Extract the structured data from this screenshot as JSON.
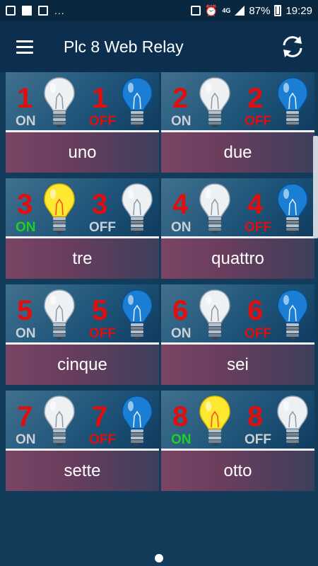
{
  "status_bar": {
    "time": "19:29",
    "battery": "87%",
    "network": "4G",
    "more": "..."
  },
  "app_bar": {
    "title": "Plc 8 Web Relay",
    "menu_icon": "hamburger-menu-icon",
    "refresh_icon": "refresh-icon"
  },
  "relays": [
    {
      "number": "1",
      "name": "uno",
      "on_label": "ON",
      "off_label": "OFF",
      "state": "off"
    },
    {
      "number": "2",
      "name": "due",
      "on_label": "ON",
      "off_label": "OFF",
      "state": "off"
    },
    {
      "number": "3",
      "name": "tre",
      "on_label": "ON",
      "off_label": "OFF",
      "state": "on"
    },
    {
      "number": "4",
      "name": "quattro",
      "on_label": "ON",
      "off_label": "OFF",
      "state": "off"
    },
    {
      "number": "5",
      "name": "cinque",
      "on_label": "ON",
      "off_label": "OFF",
      "state": "off"
    },
    {
      "number": "6",
      "name": "sei",
      "on_label": "ON",
      "off_label": "OFF",
      "state": "off"
    },
    {
      "number": "7",
      "name": "sette",
      "on_label": "ON",
      "off_label": "OFF",
      "state": "off"
    },
    {
      "number": "8",
      "name": "otto",
      "on_label": "ON",
      "off_label": "OFF",
      "state": "on"
    }
  ],
  "colors": {
    "number": "#e20d0d",
    "on_active": "#20d020",
    "off_active": "#e20d0d",
    "inactive_label": "#c9d0d6",
    "bulb_lit": "#ffe830",
    "bulb_blue": "#1a7fd4"
  }
}
